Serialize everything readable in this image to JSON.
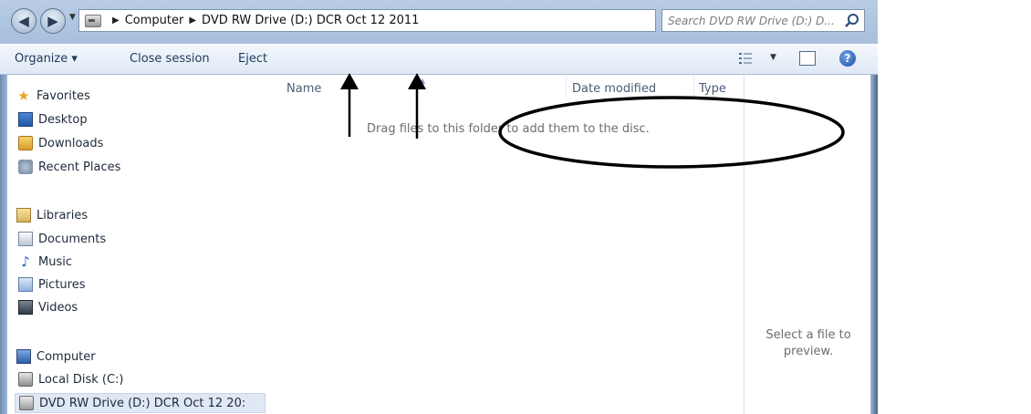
{
  "address": {
    "crumbs": [
      "Computer",
      "DVD RW Drive (D:) DCR Oct 12 2011"
    ],
    "separator": "▶",
    "search_placeholder": "Search DVD RW Drive (D:) D..."
  },
  "toolbar": {
    "organize": "Organize ▾",
    "close_session": "Close session",
    "eject": "Eject"
  },
  "nav": {
    "favorites": {
      "label": "Favorites",
      "items": [
        "Desktop",
        "Downloads",
        "Recent Places"
      ]
    },
    "libraries": {
      "label": "Libraries",
      "items": [
        "Documents",
        "Music",
        "Pictures",
        "Videos"
      ]
    },
    "computer": {
      "label": "Computer",
      "items": [
        "Local Disk (C:)",
        "DVD RW Drive (D:) DCR Oct 12 20:"
      ]
    }
  },
  "content": {
    "columns": [
      "Name",
      "Date modified",
      "Type"
    ],
    "empty_text": "Drag files to this folder to add them to the disc."
  },
  "preview": {
    "text_line1": "Select a file to",
    "text_line2": "preview."
  },
  "colors": {
    "accent": "#1e395b",
    "annotation": "#000000"
  }
}
